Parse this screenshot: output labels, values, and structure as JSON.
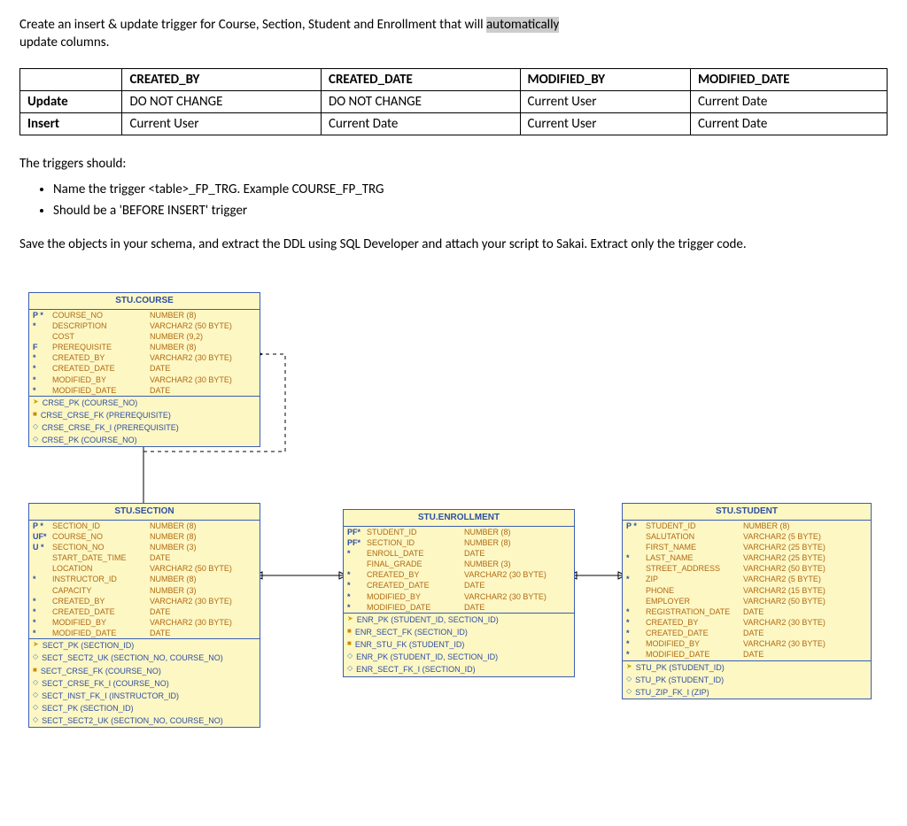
{
  "intro": {
    "line1a": "Create an insert & update trigger for Course, Section, Student and Enrollment that will ",
    "highlight": "automatically",
    "line2": "update columns."
  },
  "audit_table": {
    "headers": [
      "",
      "CREATED_BY",
      "CREATED_DATE",
      "MODIFIED_BY",
      "MODIFIED_DATE"
    ],
    "rows": [
      [
        "Update",
        "DO NOT CHANGE",
        "DO NOT CHANGE",
        "Current User",
        "Current Date"
      ],
      [
        "Insert",
        "Current User",
        "Current Date",
        "Current User",
        "Current Date"
      ]
    ]
  },
  "should_heading": "The triggers should:",
  "bullets": [
    "Name the trigger <table>_FP_TRG.  Example COURSE_FP_TRG",
    "Should be a 'BEFORE INSERT' trigger"
  ],
  "save_para": "Save the objects in your schema, and extract the DDL using SQL Developer and attach your script to Sakai.  Extract only the trigger code.",
  "entities": {
    "course": {
      "title": "STU.COURSE",
      "cols": [
        {
          "mk": "P *",
          "nm": "COURSE_NO",
          "tp": "NUMBER (8)"
        },
        {
          "mk": "*",
          "nm": "DESCRIPTION",
          "tp": "VARCHAR2 (50 BYTE)"
        },
        {
          "mk": "",
          "nm": "COST",
          "tp": "NUMBER (9,2)"
        },
        {
          "mk": "F",
          "nm": "PREREQUISITE",
          "tp": "NUMBER (8)"
        },
        {
          "mk": "*",
          "nm": "CREATED_BY",
          "tp": "VARCHAR2 (30 BYTE)"
        },
        {
          "mk": "*",
          "nm": "CREATED_DATE",
          "tp": "DATE"
        },
        {
          "mk": "*",
          "nm": "MODIFIED_BY",
          "tp": "VARCHAR2 (30 BYTE)"
        },
        {
          "mk": "*",
          "nm": "MODIFIED_DATE",
          "tp": "DATE"
        }
      ],
      "keys": [
        {
          "cls": "key",
          "txt": "CRSE_PK (COURSE_NO)"
        },
        {
          "cls": "fk2",
          "txt": "CRSE_CRSE_FK (PREREQUISITE)"
        },
        {
          "cls": "idx",
          "txt": "CRSE_CRSE_FK_I (PREREQUISITE)"
        },
        {
          "cls": "idx",
          "txt": "CRSE_PK (COURSE_NO)"
        }
      ]
    },
    "section": {
      "title": "STU.SECTION",
      "cols": [
        {
          "mk": "P *",
          "nm": "SECTION_ID",
          "tp": "NUMBER (8)"
        },
        {
          "mk": "UF*",
          "nm": "COURSE_NO",
          "tp": "NUMBER (8)"
        },
        {
          "mk": "U *",
          "nm": "SECTION_NO",
          "tp": "NUMBER (3)"
        },
        {
          "mk": "",
          "nm": "START_DATE_TIME",
          "tp": "DATE"
        },
        {
          "mk": "",
          "nm": "LOCATION",
          "tp": "VARCHAR2 (50 BYTE)"
        },
        {
          "mk": "*",
          "nm": "INSTRUCTOR_ID",
          "tp": "NUMBER (8)"
        },
        {
          "mk": "",
          "nm": "CAPACITY",
          "tp": "NUMBER (3)"
        },
        {
          "mk": "*",
          "nm": "CREATED_BY",
          "tp": "VARCHAR2 (30 BYTE)"
        },
        {
          "mk": "*",
          "nm": "CREATED_DATE",
          "tp": "DATE"
        },
        {
          "mk": "*",
          "nm": "MODIFIED_BY",
          "tp": "VARCHAR2 (30 BYTE)"
        },
        {
          "mk": "*",
          "nm": "MODIFIED_DATE",
          "tp": "DATE"
        }
      ],
      "keys": [
        {
          "cls": "key",
          "txt": "SECT_PK (SECTION_ID)"
        },
        {
          "cls": "idx",
          "txt": "SECT_SECT2_UK (SECTION_NO, COURSE_NO)"
        },
        {
          "cls": "fk2",
          "txt": "SECT_CRSE_FK (COURSE_NO)"
        },
        {
          "cls": "idx",
          "txt": "SECT_CRSE_FK_I (COURSE_NO)"
        },
        {
          "cls": "idx",
          "txt": "SECT_INST_FK_I (INSTRUCTOR_ID)"
        },
        {
          "cls": "idx",
          "txt": "SECT_PK (SECTION_ID)"
        },
        {
          "cls": "idx",
          "txt": "SECT_SECT2_UK (SECTION_NO, COURSE_NO)"
        }
      ]
    },
    "enrollment": {
      "title": "STU.ENROLLMENT",
      "cols": [
        {
          "mk": "PF*",
          "nm": "STUDENT_ID",
          "tp": "NUMBER (8)"
        },
        {
          "mk": "PF*",
          "nm": "SECTION_ID",
          "tp": "NUMBER (8)"
        },
        {
          "mk": "*",
          "nm": "ENROLL_DATE",
          "tp": "DATE"
        },
        {
          "mk": "",
          "nm": "FINAL_GRADE",
          "tp": "NUMBER (3)"
        },
        {
          "mk": "*",
          "nm": "CREATED_BY",
          "tp": "VARCHAR2 (30 BYTE)"
        },
        {
          "mk": "*",
          "nm": "CREATED_DATE",
          "tp": "DATE"
        },
        {
          "mk": "*",
          "nm": "MODIFIED_BY",
          "tp": "VARCHAR2 (30 BYTE)"
        },
        {
          "mk": "*",
          "nm": "MODIFIED_DATE",
          "tp": "DATE"
        }
      ],
      "keys": [
        {
          "cls": "key",
          "txt": "ENR_PK (STUDENT_ID, SECTION_ID)"
        },
        {
          "cls": "fk2",
          "txt": "ENR_SECT_FK (SECTION_ID)"
        },
        {
          "cls": "fk2",
          "txt": "ENR_STU_FK (STUDENT_ID)"
        },
        {
          "cls": "idx",
          "txt": "ENR_PK (STUDENT_ID, SECTION_ID)"
        },
        {
          "cls": "idx",
          "txt": "ENR_SECT_FK_I (SECTION_ID)"
        }
      ]
    },
    "student": {
      "title": "STU.STUDENT",
      "cols": [
        {
          "mk": "P *",
          "nm": "STUDENT_ID",
          "tp": "NUMBER (8)"
        },
        {
          "mk": "",
          "nm": "SALUTATION",
          "tp": "VARCHAR2 (5 BYTE)"
        },
        {
          "mk": "",
          "nm": "FIRST_NAME",
          "tp": "VARCHAR2 (25 BYTE)"
        },
        {
          "mk": "*",
          "nm": "LAST_NAME",
          "tp": "VARCHAR2 (25 BYTE)"
        },
        {
          "mk": "",
          "nm": "STREET_ADDRESS",
          "tp": "VARCHAR2 (50 BYTE)"
        },
        {
          "mk": "*",
          "nm": "ZIP",
          "tp": "VARCHAR2 (5 BYTE)"
        },
        {
          "mk": "",
          "nm": "PHONE",
          "tp": "VARCHAR2 (15 BYTE)"
        },
        {
          "mk": "",
          "nm": "EMPLOYER",
          "tp": "VARCHAR2 (50 BYTE)"
        },
        {
          "mk": "*",
          "nm": "REGISTRATION_DATE",
          "tp": "DATE"
        },
        {
          "mk": "*",
          "nm": "CREATED_BY",
          "tp": "VARCHAR2 (30 BYTE)"
        },
        {
          "mk": "*",
          "nm": "CREATED_DATE",
          "tp": "DATE"
        },
        {
          "mk": "*",
          "nm": "MODIFIED_BY",
          "tp": "VARCHAR2 (30 BYTE)"
        },
        {
          "mk": "*",
          "nm": "MODIFIED_DATE",
          "tp": "DATE"
        }
      ],
      "keys": [
        {
          "cls": "key",
          "txt": "STU_PK (STUDENT_ID)"
        },
        {
          "cls": "idx",
          "txt": "STU_PK (STUDENT_ID)"
        },
        {
          "cls": "idx",
          "txt": "STU_ZIP_FK_I (ZIP)"
        }
      ]
    }
  }
}
